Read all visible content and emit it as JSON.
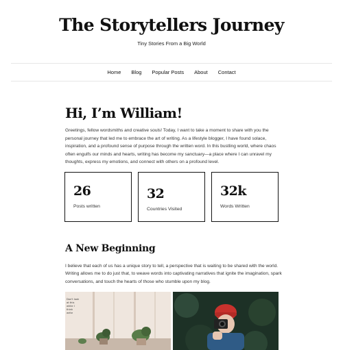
{
  "site": {
    "title": "The Storytellers Journey",
    "tagline": "Tiny Stories From a Big World"
  },
  "nav": {
    "items": [
      {
        "label": "Home"
      },
      {
        "label": "Blog"
      },
      {
        "label": "Popular Posts"
      },
      {
        "label": "About"
      },
      {
        "label": "Contact"
      }
    ]
  },
  "hero": {
    "heading": "Hi, I’m William!",
    "intro": "Greetings, fellow wordsmiths and creative souls! Today, I want to take a moment to share with you the personal journey that led me to embrace the art of writing. As a lifestyle blogger, I have found solace, inspiration, and a profound sense of purpose through the written word. In this bustling world, where chaos often engulfs our minds and hearts, writing has become my sanctuary—a place where I can unravel my thoughts, express my emotions, and connect with others on a profound level."
  },
  "stats": [
    {
      "value": "26",
      "label": "Posts written"
    },
    {
      "value": "32",
      "label": "Countries Visited"
    },
    {
      "value": "32k",
      "label": "Words Written"
    }
  ],
  "section": {
    "heading": "A New Beginning",
    "text": "I believe that each of us has a unique story to tell, a perspective that is waiting to be shared with the world. Writing allows me to do just that, to weave words into captivating narratives that ignite the imagination, spark conversations, and touch the hearts of those who stumble upon my blog."
  },
  "photos": {
    "left_note": "Don't look\nat this\nwhile I\nthink\nwrite",
    "left_icon": "plant-room-photo",
    "right_icon": "photographer-camera-photo"
  },
  "colors": {
    "text": "#111111",
    "body_text": "#333333",
    "divider": "#e6e6e6",
    "hat_red": "#c8322d"
  }
}
